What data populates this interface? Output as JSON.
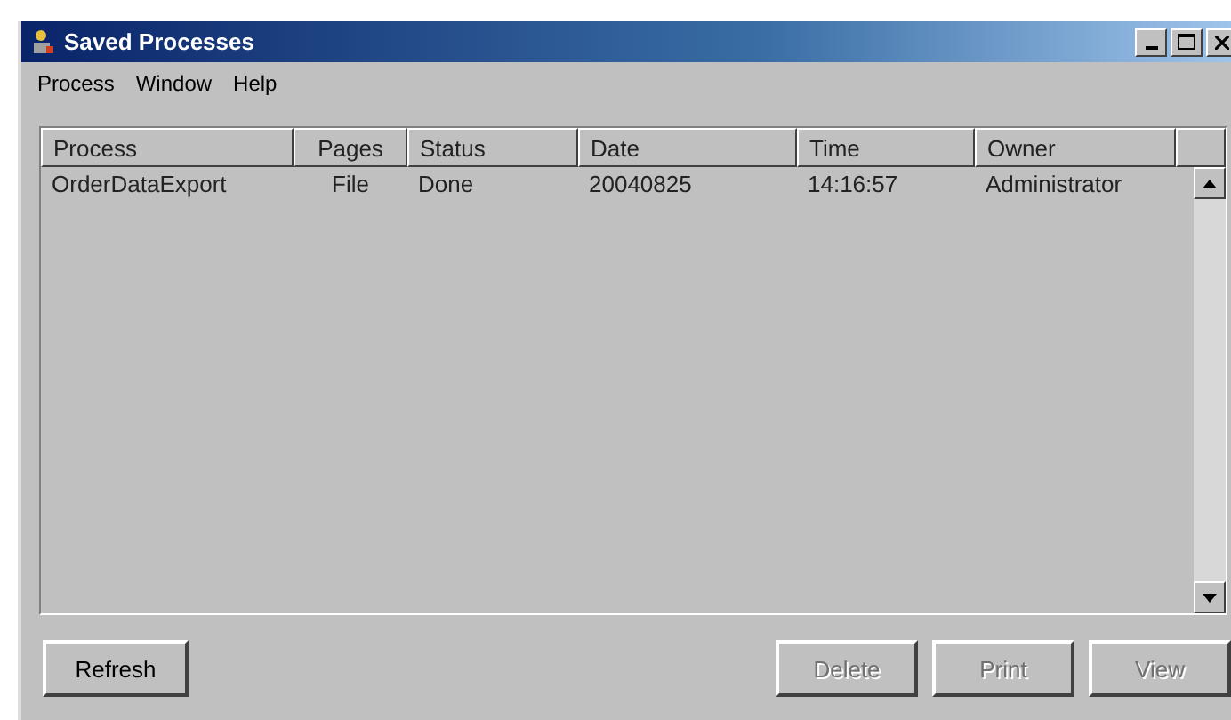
{
  "window": {
    "title": "Saved Processes"
  },
  "menu": [
    {
      "label": "Process"
    },
    {
      "label": "Window"
    },
    {
      "label": "Help"
    }
  ],
  "table": {
    "columns": [
      {
        "label": "Process"
      },
      {
        "label": "Pages"
      },
      {
        "label": "Status"
      },
      {
        "label": "Date"
      },
      {
        "label": "Time"
      },
      {
        "label": "Owner"
      }
    ],
    "rows": [
      {
        "cells": [
          "OrderDataExport",
          "File",
          "Done",
          "20040825",
          "14:16:57",
          "Administrator"
        ]
      }
    ]
  },
  "buttons": [
    {
      "label": "Refresh",
      "disabled": false
    },
    {
      "label": "Delete",
      "disabled": true
    },
    {
      "label": "Print",
      "disabled": true
    },
    {
      "label": "View",
      "disabled": true
    }
  ]
}
